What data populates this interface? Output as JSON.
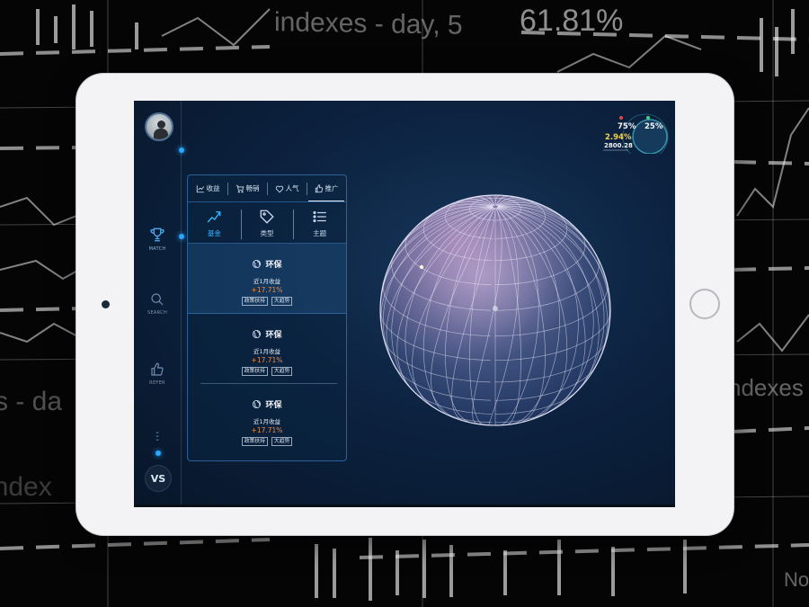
{
  "background": {
    "texts": [
      "indexes - day, 5",
      "61.81%",
      "ndexes - d",
      "s - da",
      "index",
      "Nov"
    ]
  },
  "sidebar": {
    "items": [
      {
        "label": "MATCH",
        "icon": "trophy-icon"
      },
      {
        "label": "SEARCH",
        "icon": "search-icon"
      },
      {
        "label": "REFER",
        "icon": "thumbs-up-icon"
      }
    ],
    "more_icon": "double-chevron-down-icon",
    "vs_label": "VS"
  },
  "panel": {
    "tabs": [
      {
        "label": "收益",
        "icon": "line-chart-icon"
      },
      {
        "label": "畅销",
        "icon": "cart-icon"
      },
      {
        "label": "人气",
        "icon": "heart-icon"
      },
      {
        "label": "推广",
        "icon": "thumbs-up-icon",
        "active": true
      }
    ],
    "categories": [
      {
        "label": "基金",
        "icon": "trend-up-icon",
        "active": true
      },
      {
        "label": "类型",
        "icon": "tag-icon"
      },
      {
        "label": "主题",
        "icon": "list-icon"
      }
    ],
    "cards": [
      {
        "title": "环保",
        "subtitle": "近1月收益",
        "value": "+17.71%",
        "tags": [
          "政策扶持",
          "大趋势"
        ]
      },
      {
        "title": "环保",
        "subtitle": "近1月收益",
        "value": "+17.71%",
        "tags": [
          "政策扶持",
          "大趋势"
        ]
      },
      {
        "title": "环保",
        "subtitle": "近1月收益",
        "value": "+17.71%",
        "tags": [
          "政策扶持",
          "大趋势"
        ]
      }
    ]
  },
  "stats": {
    "left_percent": "75%",
    "right_percent": "25%",
    "change": "2.94%",
    "index_value": "2800.28"
  },
  "colors": {
    "accent": "#37b6ff",
    "positive": "#f08a3a",
    "highlight_yellow": "#f2d24a",
    "screen_bg": "#0c2240"
  }
}
